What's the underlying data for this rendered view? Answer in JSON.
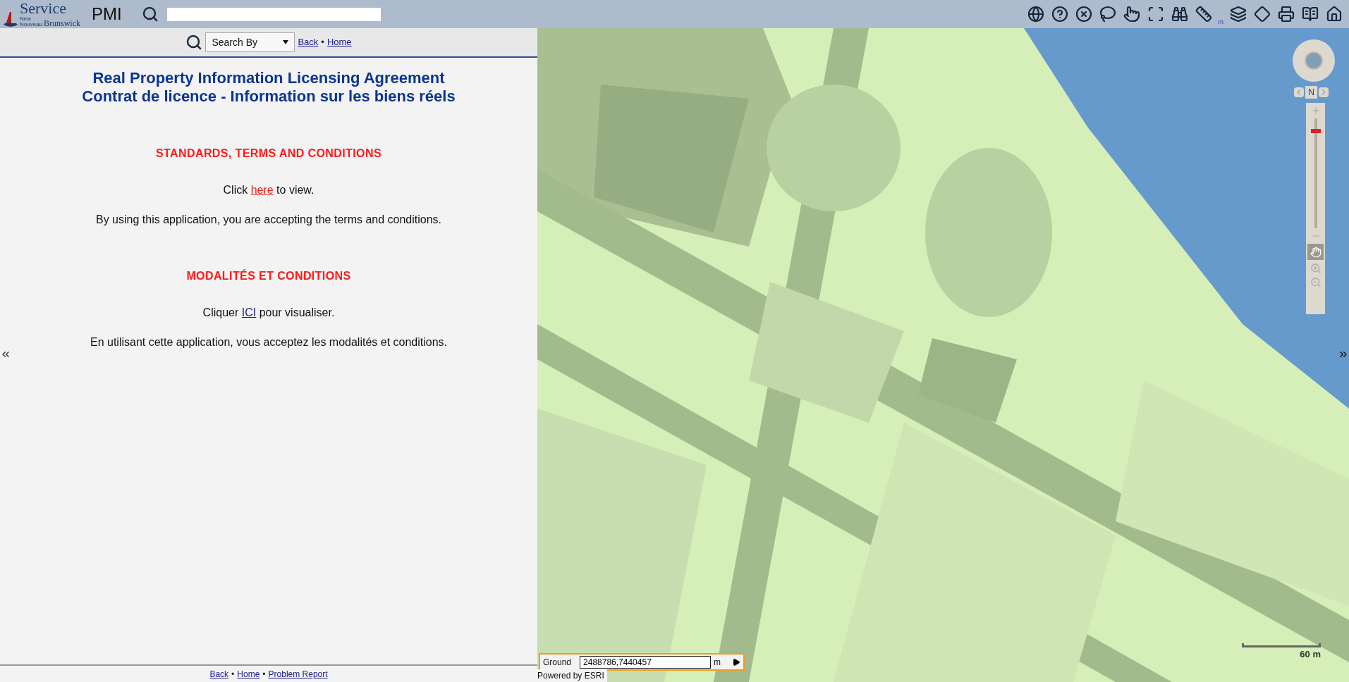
{
  "header": {
    "logo": {
      "word": "Service",
      "small_top": "New",
      "small_bottom": "Nouveau",
      "word2": "Brunswick"
    },
    "app_name": "PMI"
  },
  "toolbar": [
    {
      "kind": "globe"
    },
    {
      "kind": "help"
    },
    {
      "kind": "clear"
    },
    {
      "kind": "lasso"
    },
    {
      "kind": "pointer"
    },
    {
      "kind": "extent"
    },
    {
      "kind": "binoculars"
    },
    {
      "kind": "ruler"
    },
    {
      "kind": "layers"
    },
    {
      "kind": "diamond"
    },
    {
      "kind": "print"
    },
    {
      "kind": "reader"
    },
    {
      "kind": "home"
    }
  ],
  "toolbar_mark": "m",
  "search_row": {
    "dropdown": "Search By",
    "links": [
      "Back",
      "Home"
    ],
    "separator": "•"
  },
  "agreement": {
    "titles": [
      "Real Property Information Licensing Agreement",
      "Contrat de licence - Information sur les biens réels"
    ],
    "sections": [
      {
        "heading": "STANDARDS, TERMS AND CONDITIONS",
        "link_line": {
          "before": "Click ",
          "link": "here",
          "after": " to view.",
          "color": "#e8201f"
        },
        "note": "By using this application, you are accepting the terms and conditions."
      },
      {
        "heading": "MODALITÉS ET CONDITIONS",
        "link_line": {
          "before": "Cliquer ",
          "link": "ICI",
          "after": " pour visualiser.",
          "color": "#1a1a8c"
        },
        "note": "En utilisant cette application, vous acceptez les modalités et conditions."
      }
    ]
  },
  "footer": {
    "links": [
      "Back",
      "Home",
      "Problem Report"
    ],
    "separator": "•"
  },
  "map": {
    "kind": "picture",
    "zoom_slider": {
      "level": 0.9
    },
    "compass_label": "N",
    "scale": "60 m",
    "coordinates": {
      "label": "Ground",
      "value": "2488786,7440457",
      "unit": "m"
    },
    "credit": "Powered by ESRI"
  }
}
